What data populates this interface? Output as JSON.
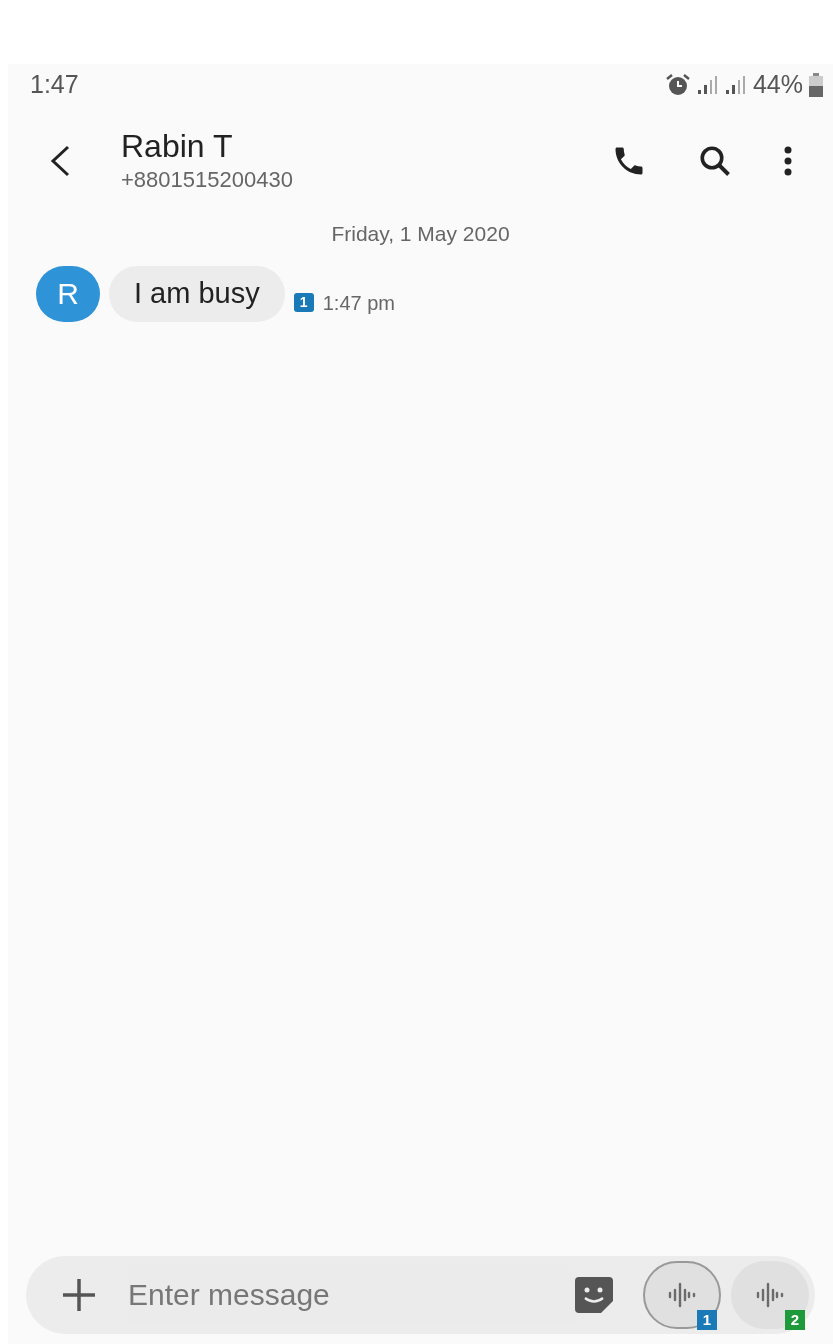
{
  "status_bar": {
    "time": "1:47",
    "battery": "44%"
  },
  "header": {
    "name": "Rabin T",
    "number": "+8801515200430"
  },
  "date_divider": "Friday, 1 May 2020",
  "messages": [
    {
      "avatar": "R",
      "text": "I am busy",
      "sim": "1",
      "color": "#1a7ab8",
      "time": "1:47 pm"
    }
  ],
  "composer": {
    "placeholder": "Enter message",
    "send_buttons": [
      {
        "sim": "1",
        "color": "#1a7ab8",
        "selected": true
      },
      {
        "sim": "2",
        "color": "#1e9a3a",
        "selected": false
      }
    ]
  }
}
